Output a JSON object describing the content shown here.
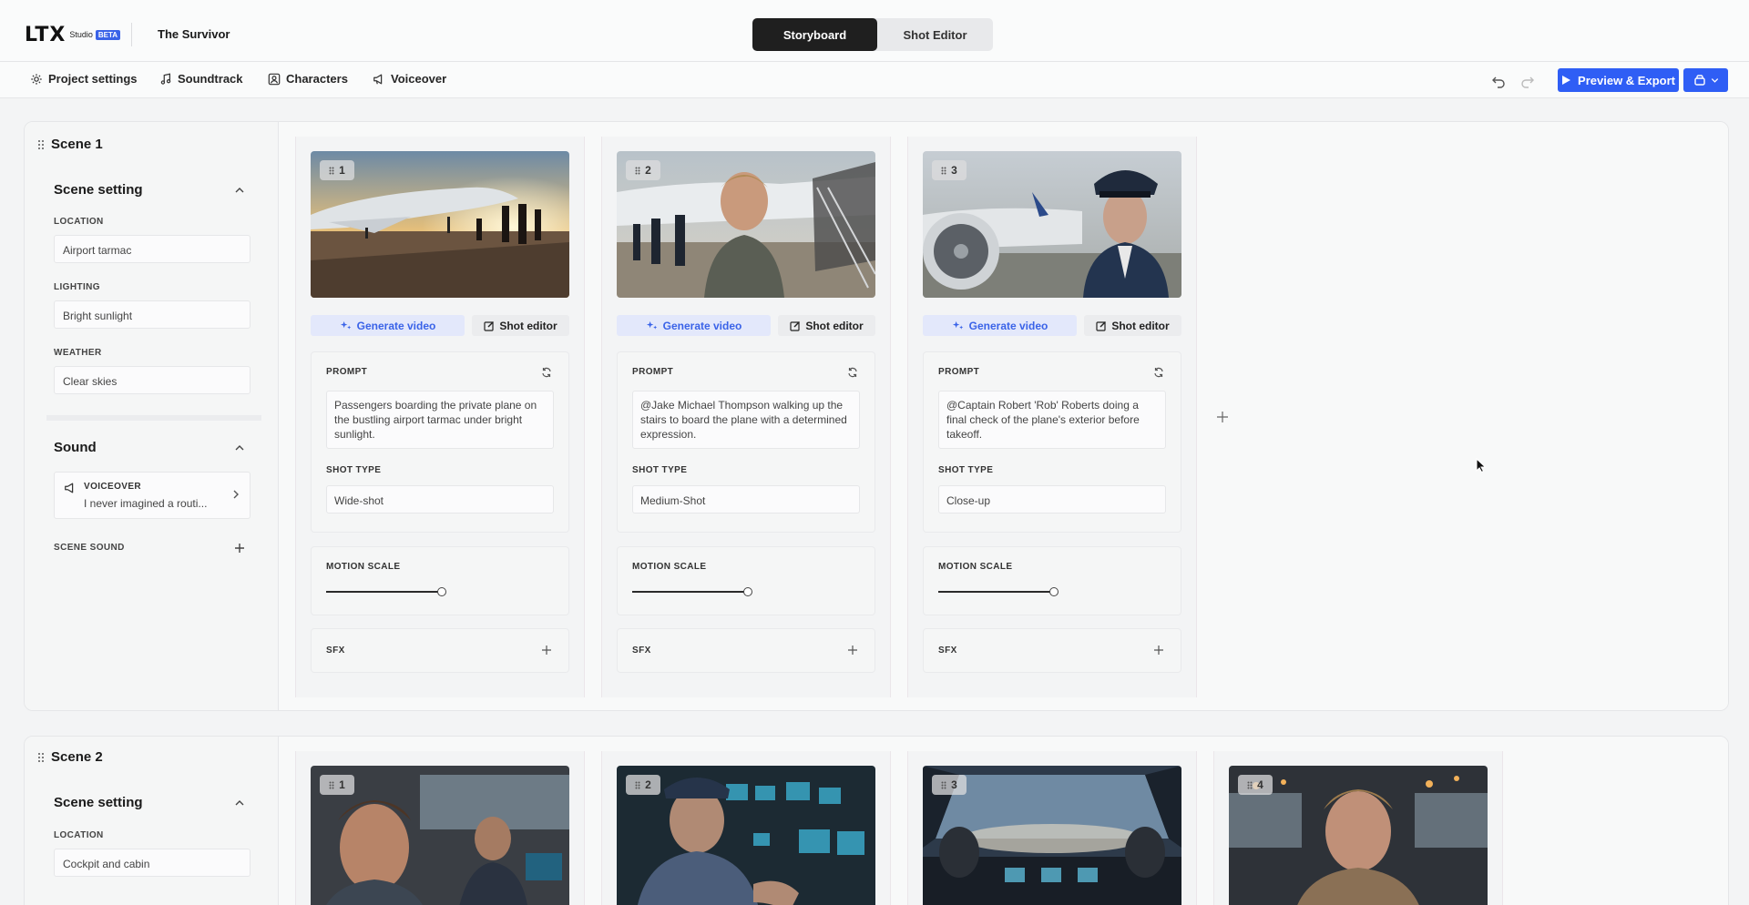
{
  "header": {
    "logo": "LTX",
    "logo_studio": "Studio",
    "logo_badge": "BETA",
    "project_title": "The Survivor",
    "tabs": [
      {
        "label": "Storyboard",
        "active": true
      },
      {
        "label": "Shot Editor",
        "active": false
      }
    ]
  },
  "toolbar": {
    "items": [
      {
        "label": "Project settings",
        "icon": "gear-icon"
      },
      {
        "label": "Soundtrack",
        "icon": "music-note-icon"
      },
      {
        "label": "Characters",
        "icon": "character-icon"
      },
      {
        "label": "Voiceover",
        "icon": "megaphone-icon"
      }
    ],
    "preview_export_label": "Preview & Export",
    "accent_color": "#2f5ef5"
  },
  "scenes": [
    {
      "title": "Scene 1",
      "scene_setting_label": "Scene setting",
      "location_label": "LOCATION",
      "location": "Airport tarmac",
      "lighting_label": "LIGHTING",
      "lighting": "Bright sunlight",
      "weather_label": "WEATHER",
      "weather": "Clear skies",
      "sound_label": "Sound",
      "voiceover_label": "VOICEOVER",
      "voiceover_text": "I never imagined a routi...",
      "scene_sound_label": "SCENE SOUND",
      "shots": [
        {
          "number": "1",
          "generate_label": "Generate video",
          "editor_label": "Shot editor",
          "prompt_label": "PROMPT",
          "prompt": "Passengers boarding the private plane on the bustling airport tarmac under bright sunlight.",
          "shot_type_label": "SHOT TYPE",
          "shot_type": "Wide-shot",
          "motion_label": "MOTION SCALE",
          "motion_scale": 0.85,
          "sfx_label": "SFX"
        },
        {
          "number": "2",
          "generate_label": "Generate video",
          "editor_label": "Shot editor",
          "prompt_label": "PROMPT",
          "prompt": "@Jake Michael Thompson walking up the stairs to board the plane with a determined expression.",
          "shot_type_label": "SHOT TYPE",
          "shot_type": "Medium-Shot",
          "motion_label": "MOTION SCALE",
          "motion_scale": 0.85,
          "sfx_label": "SFX"
        },
        {
          "number": "3",
          "generate_label": "Generate video",
          "editor_label": "Shot editor",
          "prompt_label": "PROMPT",
          "prompt": "@Captain Robert 'Rob' Roberts doing a final check of the plane's exterior before takeoff.",
          "shot_type_label": "SHOT TYPE",
          "shot_type": "Close-up",
          "motion_label": "MOTION SCALE",
          "motion_scale": 0.85,
          "sfx_label": "SFX"
        }
      ]
    },
    {
      "title": "Scene 2",
      "scene_setting_label": "Scene setting",
      "location_label": "LOCATION",
      "location": "Cockpit and cabin",
      "shots": [
        {
          "number": "1"
        },
        {
          "number": "2"
        },
        {
          "number": "3"
        },
        {
          "number": "4"
        }
      ]
    }
  ]
}
